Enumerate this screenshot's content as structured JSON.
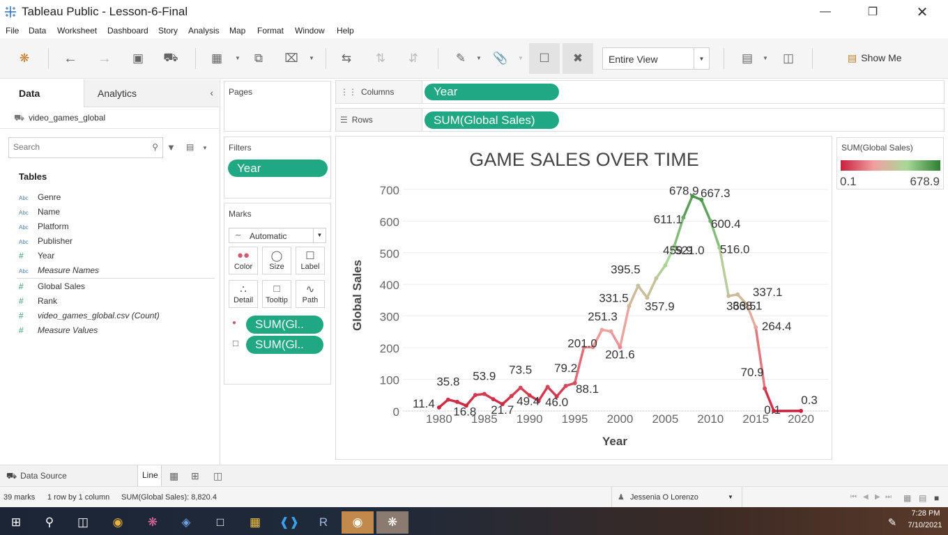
{
  "window": {
    "title": "Tableau Public - Lesson-6-Final"
  },
  "menu": [
    "File",
    "Data",
    "Worksheet",
    "Dashboard",
    "Story",
    "Analysis",
    "Map",
    "Format",
    "Window",
    "Help"
  ],
  "toolbar": {
    "fit_value": "Entire View",
    "show_me_label": "Show Me"
  },
  "data_pane": {
    "tabs": {
      "data": "Data",
      "analytics": "Analytics"
    },
    "datasource": "video_games_global",
    "search_placeholder": "Search",
    "tables_heading": "Tables",
    "fields": [
      {
        "type": "Abc",
        "name": "Genre"
      },
      {
        "type": "Abc",
        "name": "Name"
      },
      {
        "type": "Abc",
        "name": "Platform"
      },
      {
        "type": "Abc",
        "name": "Publisher"
      },
      {
        "type": "#",
        "name": "Year"
      },
      {
        "type": "Abc",
        "name": "Measure Names"
      },
      {
        "type": "#",
        "name": "Global Sales"
      },
      {
        "type": "#",
        "name": "Rank"
      },
      {
        "type": "#",
        "name": "video_games_global.csv (Count)"
      },
      {
        "type": "#",
        "name": "Measure Values"
      }
    ]
  },
  "shelves": {
    "pages_label": "Pages",
    "filters_label": "Filters",
    "filters_pill": "Year",
    "marks_label": "Marks",
    "mark_type": "Automatic",
    "mark_buttons": [
      "Color",
      "Size",
      "Label",
      "Detail",
      "Tooltip",
      "Path"
    ],
    "mark_pills": [
      "SUM(Gl..",
      "SUM(Gl.."
    ],
    "columns_label": "Columns",
    "columns_pill": "Year",
    "rows_label": "Rows",
    "rows_pill": "SUM(Global Sales)"
  },
  "legend": {
    "title": "SUM(Global Sales)",
    "min_label": "0.1",
    "max_label": "678.9",
    "colors": [
      "#c8203c",
      "#f0a0a0",
      "#a8d898",
      "#2e7d32"
    ]
  },
  "chart_data": {
    "type": "line",
    "title": "GAME SALES OVER TIME",
    "xlabel": "Year",
    "ylabel": "Global Sales",
    "xlim": [
      1976,
      2023
    ],
    "ylim": [
      0,
      735
    ],
    "x_ticks": [
      1980,
      1985,
      1990,
      1995,
      2000,
      2005,
      2010,
      2015,
      2020
    ],
    "y_ticks": [
      0,
      100,
      200,
      300,
      400,
      500,
      600,
      700
    ],
    "x": [
      1980,
      1981,
      1982,
      1983,
      1984,
      1985,
      1986,
      1987,
      1988,
      1989,
      1990,
      1991,
      1992,
      1993,
      1994,
      1995,
      1996,
      1997,
      1998,
      1999,
      2000,
      2001,
      2002,
      2003,
      2004,
      2005,
      2006,
      2007,
      2008,
      2009,
      2010,
      2011,
      2012,
      2013,
      2014,
      2015,
      2016,
      2017,
      2020
    ],
    "values": [
      11.4,
      35.8,
      28.9,
      16.8,
      50.4,
      53.9,
      37.1,
      21.7,
      47.2,
      73.5,
      49.4,
      32.2,
      76.2,
      46.0,
      79.2,
      88.1,
      201.0,
      201.6,
      256.5,
      251.3,
      201.6,
      331.5,
      395.5,
      357.9,
      419.3,
      459.9,
      521.0,
      611.1,
      678.9,
      667.3,
      600.4,
      516.0,
      363.5,
      368.1,
      337.1,
      264.4,
      70.9,
      0.1,
      0.3
    ],
    "labels": [
      {
        "x": 1980,
        "text": "11.4"
      },
      {
        "x": 1981,
        "text": "35.8"
      },
      {
        "x": 1983,
        "text": "16.8"
      },
      {
        "x": 1985,
        "text": "53.9"
      },
      {
        "x": 1987,
        "text": "21.7"
      },
      {
        "x": 1989,
        "text": "73.5"
      },
      {
        "x": 1990,
        "text": "49.4"
      },
      {
        "x": 1993,
        "text": "46.0"
      },
      {
        "x": 1994,
        "text": "79.2"
      },
      {
        "x": 1995,
        "text": "88.1"
      },
      {
        "x": 1996,
        "text": "201.0"
      },
      {
        "x": 1999,
        "text": "251.3"
      },
      {
        "x": 2000,
        "text": "201.6"
      },
      {
        "x": 2001,
        "text": "331.5"
      },
      {
        "x": 2002,
        "text": "395.5"
      },
      {
        "x": 2003,
        "text": "357.9"
      },
      {
        "x": 2005,
        "text": "459.9"
      },
      {
        "x": 2006,
        "text": "521.0"
      },
      {
        "x": 2007,
        "text": "611.1"
      },
      {
        "x": 2008,
        "text": "678.9"
      },
      {
        "x": 2009,
        "text": "667.3"
      },
      {
        "x": 2010,
        "text": "600.4"
      },
      {
        "x": 2011,
        "text": "516.0"
      },
      {
        "x": 2012,
        "text": "363.5"
      },
      {
        "x": 2013,
        "text": "368.1"
      },
      {
        "x": 2014,
        "text": "337.1"
      },
      {
        "x": 2015,
        "text": "264.4"
      },
      {
        "x": 2016,
        "text": "70.9"
      },
      {
        "x": 2017,
        "text": "0.1"
      },
      {
        "x": 2020,
        "text": "0.3"
      }
    ],
    "color_scale": [
      "#c8203c",
      "#f0a0a0",
      "#a8d898",
      "#2e7d32"
    ]
  },
  "sheet_tabs": {
    "data_source": "Data Source",
    "active_sheet": "Line"
  },
  "status": {
    "marks": "39 marks",
    "layout": "1 row by 1 column",
    "sum": "SUM(Global Sales): 8,820.4",
    "user": "Jessenia O Lorenzo"
  },
  "taskbar": {
    "time": "7:28 PM",
    "date": "7/10/2021",
    "r_label": "R"
  }
}
